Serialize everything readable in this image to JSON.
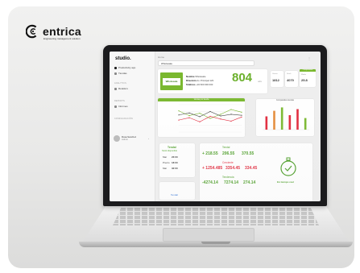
{
  "brand": {
    "name": "entrica",
    "tagline": "Engineering management solution"
  },
  "app": {
    "name": "studio.",
    "breadcrumb": "Home",
    "store_select": "Wholesale",
    "nav": [
      {
        "label": "Productivity app",
        "icon": "home-icon",
        "active": true
      },
      {
        "label": "Tiendas",
        "icon": "store-icon",
        "active": false
      }
    ],
    "sections": [
      {
        "label": "ANALYTICS",
        "items": [
          "Retailers"
        ]
      },
      {
        "label": "REPORTS",
        "items": [
          "Informes"
        ]
      },
      {
        "label": "CONFIGURACIÓN",
        "items": []
      }
    ],
    "profile": {
      "name": "Rosa Sanchez",
      "role": "Admin"
    }
  },
  "store": {
    "logo_text": "Wholesale",
    "name_label": "Nombre",
    "name_value": "Wholesale",
    "address_label": "Dirección",
    "address_value": "Av. Principal 123",
    "phone_label": "Teléfono",
    "phone_value": "+34 600 000 000",
    "kpi_value": "804",
    "kpi_unit": "uds"
  },
  "minis": [
    {
      "head": "",
      "label": "Ventas",
      "value": "1812"
    },
    {
      "head": "",
      "label": "Stock",
      "value": "4070"
    },
    {
      "head": "Comparativa",
      "label": "Media",
      "value": "25.8"
    }
  ],
  "charts": {
    "line_title": "Ventas por tienda",
    "bar_title": "Comparativa tiendas"
  },
  "chart_data": [
    {
      "type": "line",
      "title": "Ventas por tienda",
      "series": [
        {
          "name": "",
          "color": "#7ab82f",
          "values": [
            62,
            48,
            55,
            40,
            52,
            66,
            58
          ]
        },
        {
          "name": "",
          "color": "#e2283b",
          "values": [
            35,
            42,
            30,
            46,
            38,
            32,
            44
          ]
        },
        {
          "name": "",
          "color": "#444444",
          "values": [
            50,
            56,
            45,
            60,
            47,
            52,
            49
          ]
        }
      ],
      "categories": [
        "",
        "",
        "",
        "",
        "",
        "",
        ""
      ],
      "ylim": [
        0,
        80
      ]
    },
    {
      "type": "bar",
      "title": "Comparativa tiendas",
      "categories": [
        "",
        "",
        "",
        "",
        "",
        ""
      ],
      "values": [
        55,
        78,
        92,
        60,
        85,
        48
      ],
      "colors": [
        "#e2283b",
        "#e58c3a",
        "#7ab82f",
        "#e2283b",
        "#e2283b",
        "#7ab82f"
      ],
      "ylim": [
        0,
        100
      ]
    }
  ],
  "stock_table": {
    "title": "Tendal",
    "subtitle": "Stock disponible",
    "rows": [
      {
        "label": "Mar",
        "value": "23:00"
      },
      {
        "label": "Precio",
        "value": "18:00"
      },
      {
        "label": "Mar",
        "value": "32:00"
      }
    ]
  },
  "totals": {
    "title": "Tendal",
    "row1": [
      "+ 218.55",
      "206.55",
      "370.55"
    ],
    "mid_title": "Creciente",
    "row2": [
      "+ 1254.485",
      "3354.45",
      "334.45"
    ],
    "bottom_title": "Tendencia",
    "row3": [
      "-4274.14",
      "7274.14",
      "274.14"
    ]
  },
  "status": {
    "label": "En tiempo real"
  },
  "bottom_card": {
    "label": "Tendal"
  }
}
